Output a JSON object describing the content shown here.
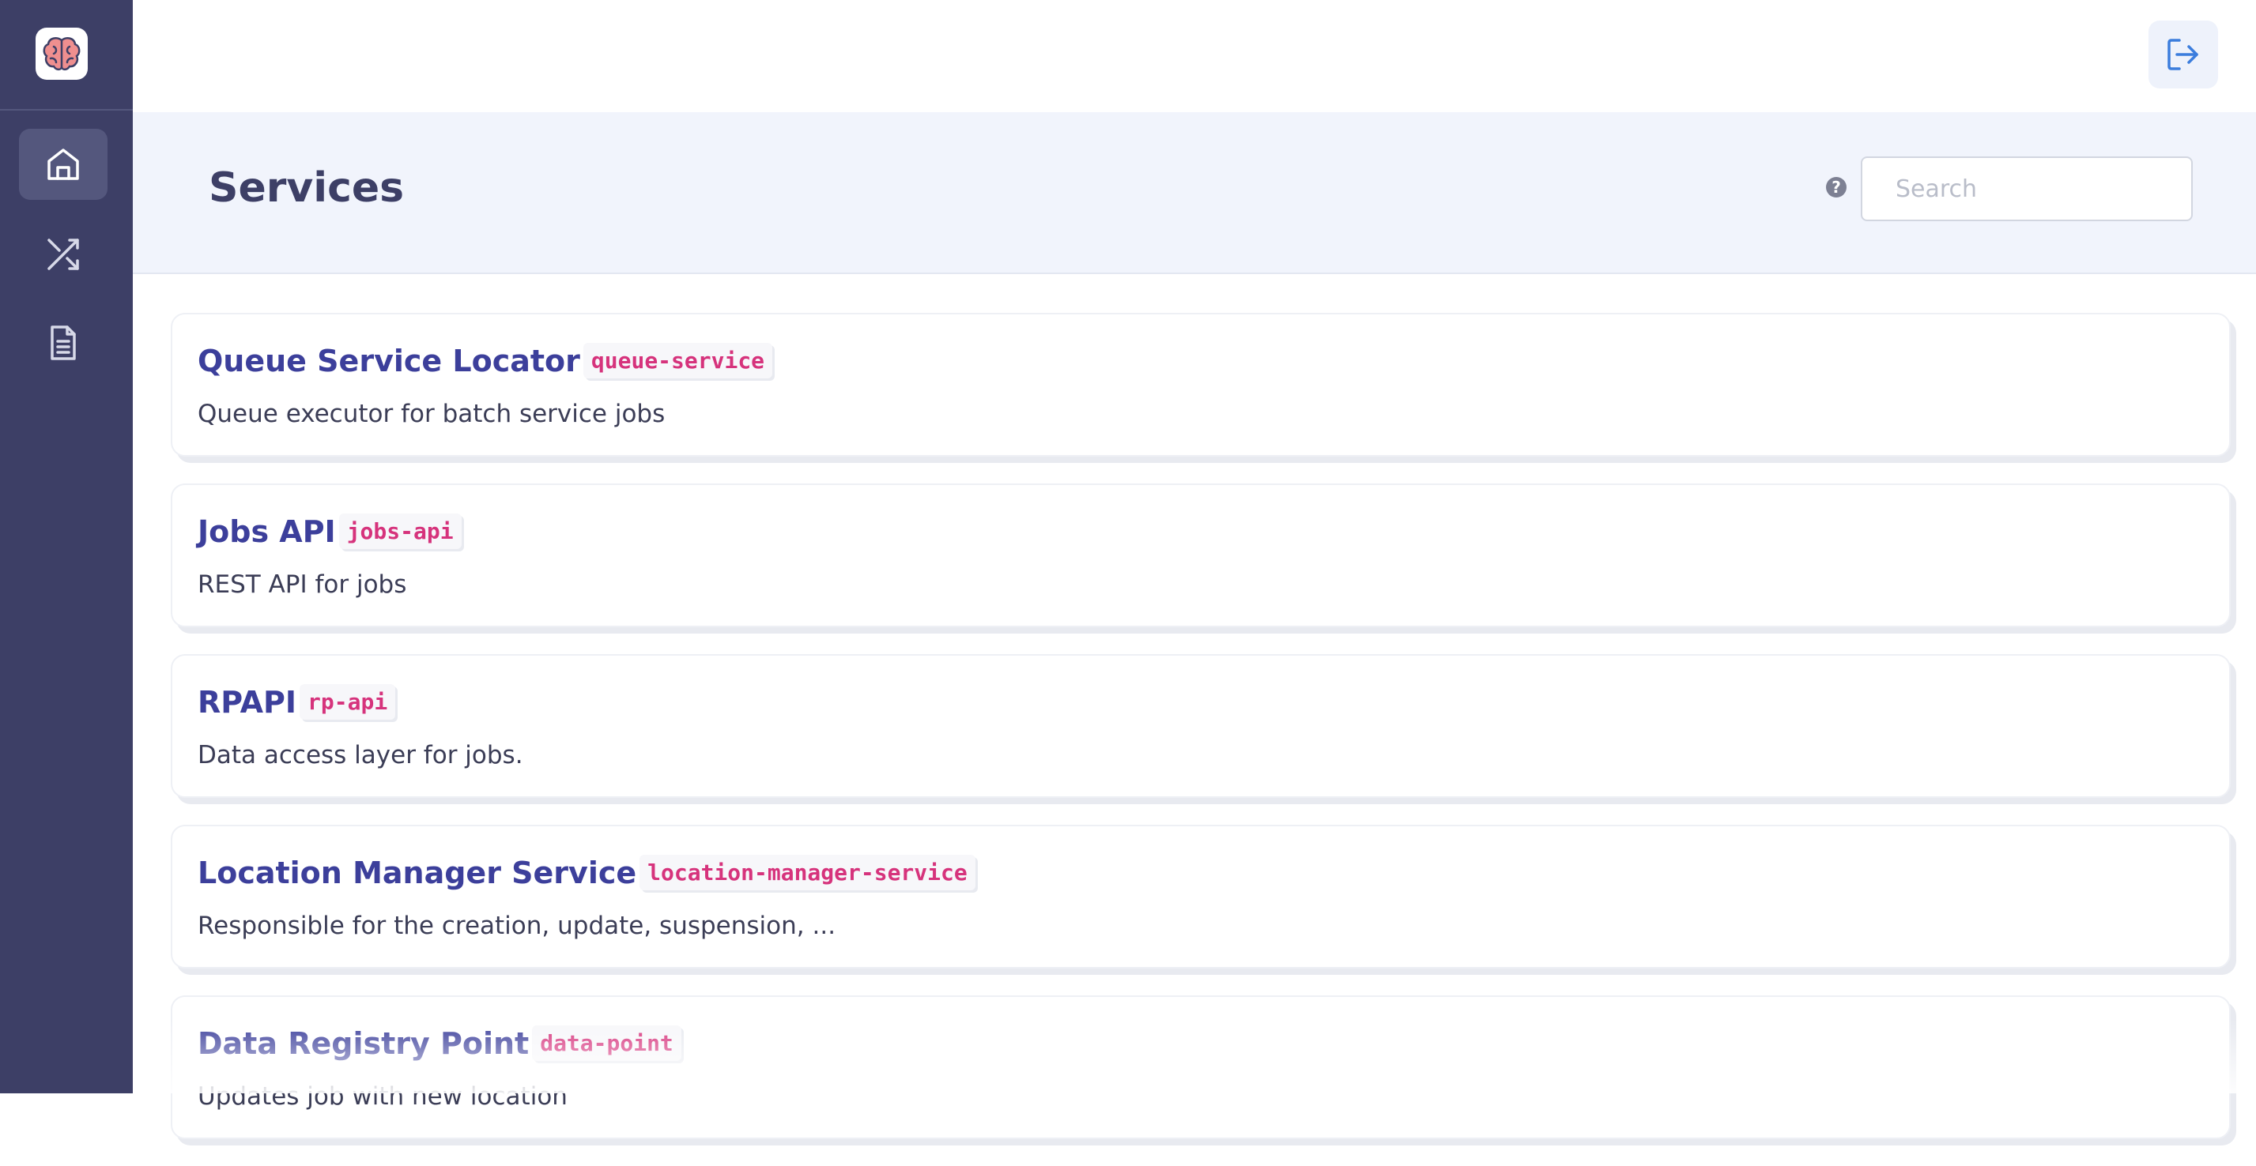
{
  "sidebar": {
    "logo_icon": "brain-icon",
    "items": [
      {
        "icon": "home-icon",
        "active": true
      },
      {
        "icon": "shuffle-icon",
        "active": false
      },
      {
        "icon": "document-icon",
        "active": false
      }
    ]
  },
  "topbar": {
    "logout_icon": "logout-icon"
  },
  "header": {
    "title": "Services",
    "help_icon": "question-icon",
    "help_glyph": "?",
    "search_placeholder": "Search",
    "search_value": ""
  },
  "services": [
    {
      "name": "Queue Service Locator",
      "slug": "queue-service",
      "description": "Queue executor for batch service jobs"
    },
    {
      "name": "Jobs API",
      "slug": "jobs-api",
      "description": "REST API for jobs"
    },
    {
      "name": "RPAPI",
      "slug": "rp-api",
      "description": "Data access layer for jobs."
    },
    {
      "name": "Location Manager Service",
      "slug": "location-manager-service",
      "description": "Responsible for the creation, update, suspension, ..."
    },
    {
      "name": "Data Registry Point",
      "slug": "data-point",
      "description": "Updates job with new location"
    }
  ],
  "colors": {
    "sidebar_bg": "#3d3f66",
    "header_bg": "#f1f4fc",
    "service_name": "#3c3f9b",
    "slug_text": "#d6337c",
    "accent_blue": "#3b7ddd"
  }
}
